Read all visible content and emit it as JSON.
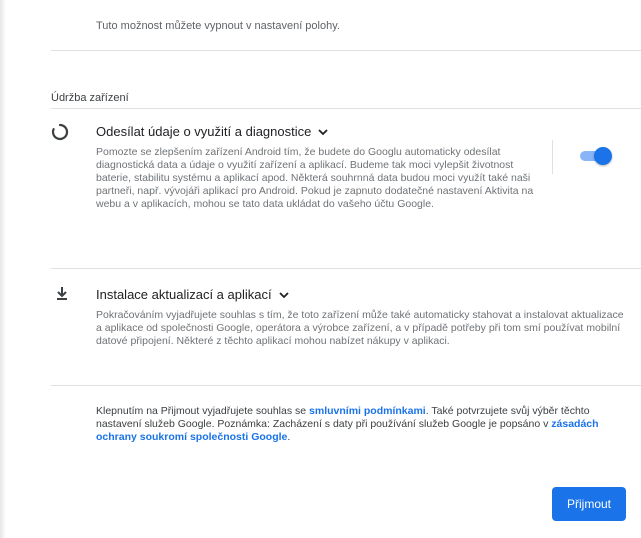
{
  "previous_section": {
    "text": "Tuto možnost můžete vypnout v nastavení polohy."
  },
  "maintenance": {
    "section_title": "Údržba zařízení",
    "diagnostics": {
      "icon": "loading-circle-icon",
      "title": "Odesílat údaje o využití a diagnostice",
      "description": "Pomozte se zlepšením zařízení Android tím, že budete do Googlu automaticky odesílat diagnostická data a údaje o využití zařízení a aplikací. Budeme tak moci vylepšit životnost baterie, stabilitu systému a aplikací apod. Některá souhrnná data budou moci využít také naši partneři, např. vývojáři aplikací pro Android. Pokud je zapnuto dodatečné nastavení Aktivita na webu a v aplikacích, mohou se tato data ukládat do vašeho účtu Google.",
      "toggle_on": true
    },
    "updates": {
      "icon": "download-icon",
      "title": "Instalace aktualizací a aplikací",
      "description": "Pokračováním vyjadřujete souhlas s tím, že toto zařízení může také automaticky stahovat a instalovat aktualizace a aplikace od společnosti Google, operátora a výrobce zařízení, a v případě potřeby při tom smí používat mobilní datové připojení. Některé z těchto aplikací mohou nabízet nákupy v aplikaci."
    }
  },
  "consent": {
    "part1": "Klepnutím na Přijmout vyjadřujete souhlas se ",
    "terms_link": "smluvními podmínkami",
    "part2": ". Také potvrzujete svůj výběr těchto nastavení služeb Google. Poznámka: Zacházení s daty při používání služeb Google je popsáno v ",
    "privacy_link": "zásadách ochrany soukromí společnosti Google",
    "part3": "."
  },
  "accept_button": {
    "label": "Přijmout"
  },
  "colors": {
    "accent": "#1a73e8",
    "toggle_track": "#8ab4f8",
    "secondary_text": "#6f7377"
  }
}
